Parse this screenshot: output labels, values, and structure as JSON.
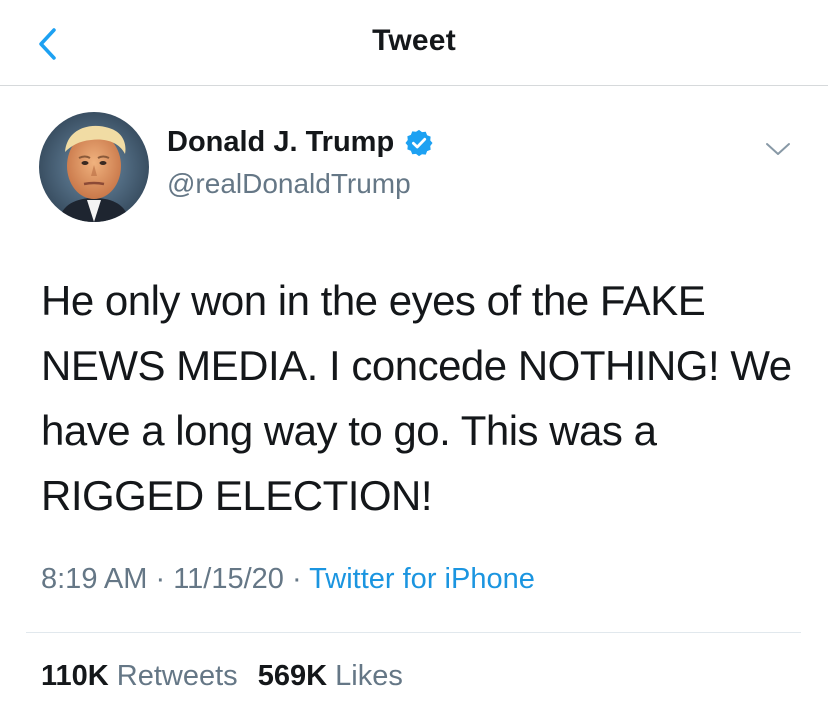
{
  "header": {
    "title": "Tweet",
    "back_icon": "chevron-left-icon"
  },
  "author": {
    "name": "Donald J. Trump",
    "handle": "@realDonaldTrump",
    "verified": true
  },
  "tweet": {
    "text": "He only won in the eyes of the FAKE NEWS MEDIA. I concede NOTHING! We have a long way to go. This was a RIGGED ELECTION!",
    "time": "8:19 AM",
    "date": "11/15/20",
    "source": "Twitter for iPhone",
    "separator": " · "
  },
  "stats": {
    "retweets_count": "110K",
    "retweets_label": "Retweets",
    "likes_count": "569K",
    "likes_label": "Likes"
  },
  "colors": {
    "accent": "#1da1f2",
    "link": "#1b95e0",
    "secondary_text": "#657786",
    "primary_text": "#14171a",
    "divider": "#e1e8ed"
  }
}
